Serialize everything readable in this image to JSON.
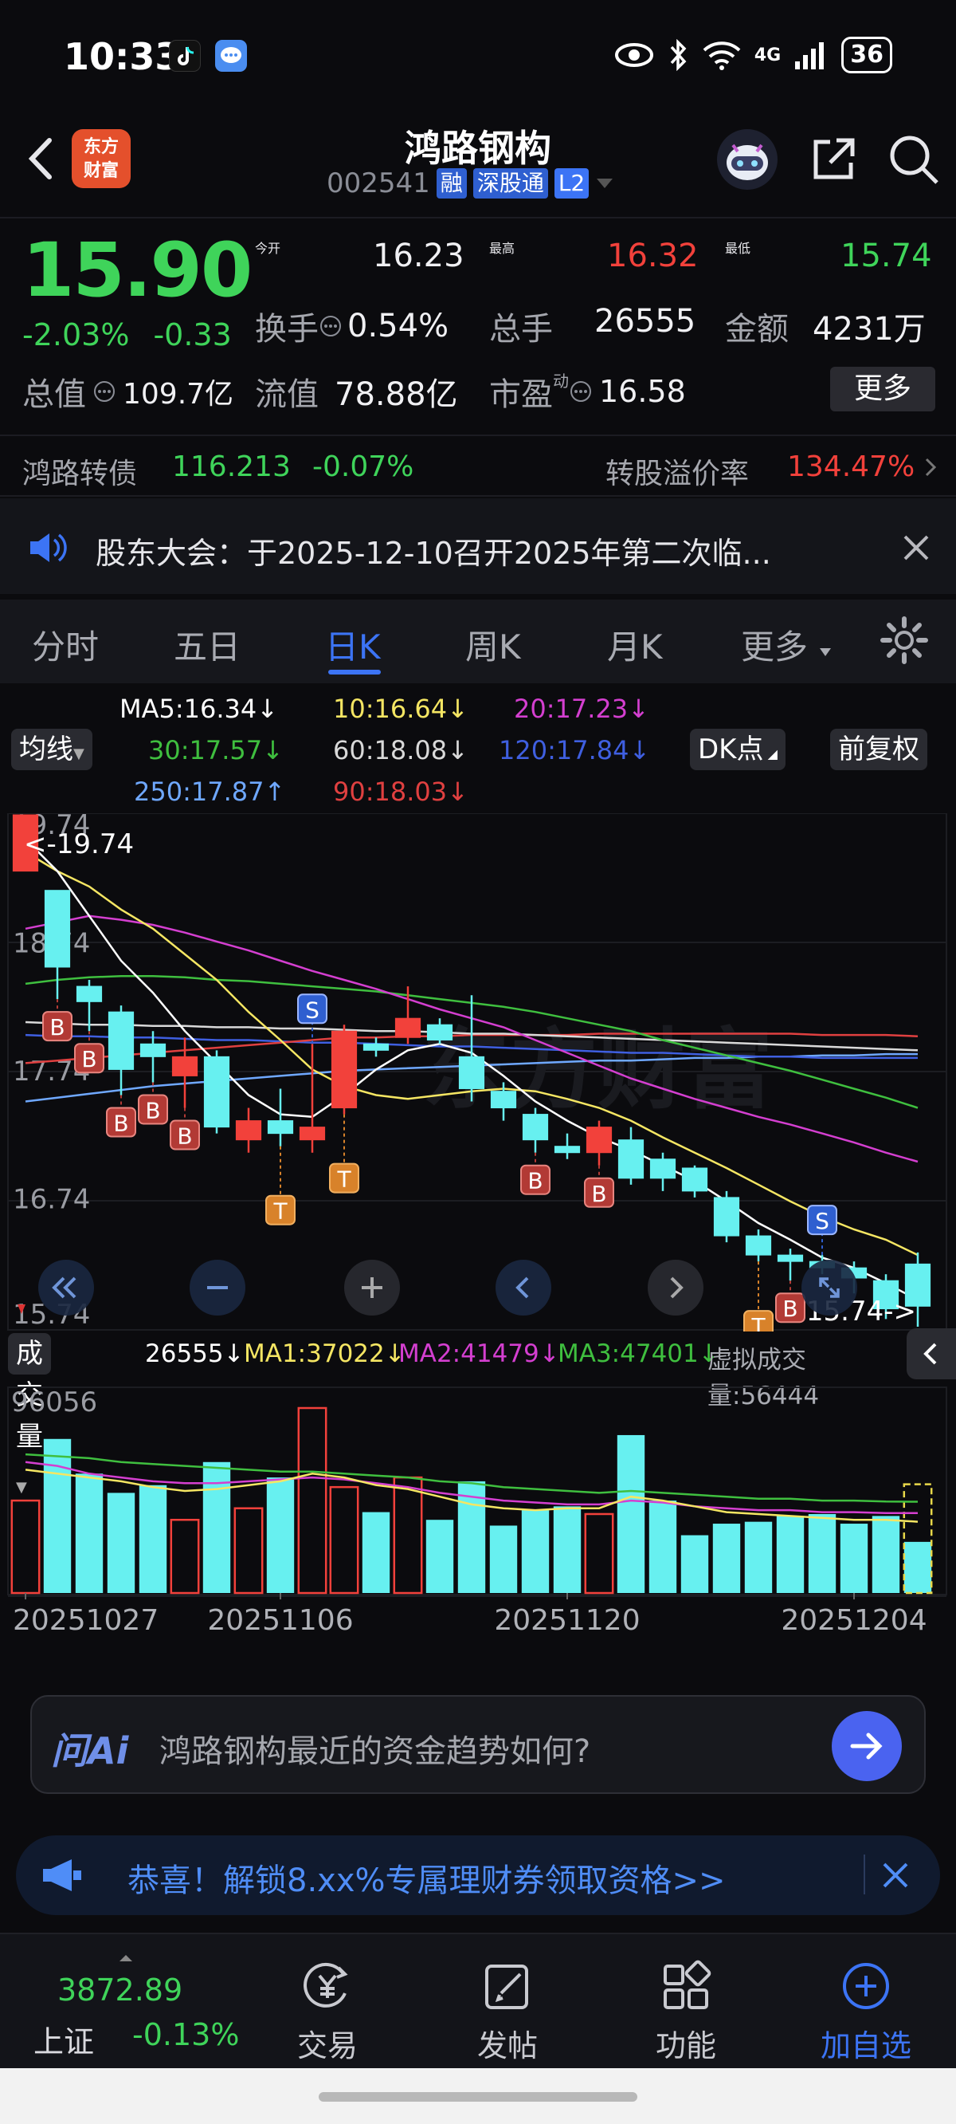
{
  "status_bar": {
    "time": "10:33",
    "network": "4G",
    "battery": "36"
  },
  "header": {
    "back_icon": "chevron-left-icon",
    "logo_text_1": "东方",
    "logo_text_2": "财富",
    "stock_name": "鸿路钢构",
    "stock_code": "002541",
    "tags": [
      "融",
      "深股通",
      "L2"
    ],
    "icons": [
      "robot-assistant-icon",
      "share-icon",
      "search-icon"
    ]
  },
  "quote": {
    "price": "15.90",
    "change_pct": "-2.03%",
    "change_amt": "-0.33",
    "open_label": "今开",
    "open": "16.23",
    "high_label": "最高",
    "high": "16.32",
    "low_label": "最低",
    "low": "15.74",
    "turnover_label": "换手",
    "turnover": "0.54%",
    "volume_label": "总手",
    "volume": "26555",
    "amount_label": "金额",
    "amount": "4231万",
    "mktcap_label": "总值",
    "mktcap": "109.7亿",
    "float_label": "流值",
    "float": "78.88亿",
    "pe_label": "市盈",
    "pe_sup": "动",
    "pe": "16.58",
    "more_label": "更多"
  },
  "convertible": {
    "name": "鸿路转债",
    "price": "116.213",
    "change": "-0.07%",
    "premium_label": "转股溢价率",
    "premium": "134.47%"
  },
  "notice": {
    "text": "股东大会：于2025-12-10召开2025年第二次临..."
  },
  "tabs": [
    {
      "label": "分时"
    },
    {
      "label": "五日"
    },
    {
      "label": "日K"
    },
    {
      "label": "周K"
    },
    {
      "label": "月K"
    },
    {
      "label": "更多"
    }
  ],
  "active_tab": "日K",
  "ma_legend": {
    "ma5": "MA5:16.34↓",
    "ma10": "10:16.64↓",
    "ma20": "20:17.23↓",
    "ma30": "30:17.57↓",
    "ma60": "60:18.08↓",
    "ma120": "120:17.84↓",
    "ma250": "250:17.87↑",
    "ma90": "90:18.03↓",
    "indicator_btn": "均线",
    "dk_btn": "DK点",
    "adjust_btn": "前复权"
  },
  "colors": {
    "up": "#f2413b",
    "down": "#67f0f0",
    "ma5": "#ffffff",
    "ma10": "#f5e663",
    "ma20": "#d43fd0",
    "ma30": "#3fbf3f",
    "ma60": "#d9d9d9",
    "ma120": "#3f5fe0",
    "ma250": "#6fa8ff",
    "ma90": "#e04040",
    "accent": "#3c74f5"
  },
  "chart_data": {
    "type": "candlestick",
    "price_axis": [
      "19.74",
      "18.74",
      "17.74",
      "16.74",
      "15.74"
    ],
    "ylim": [
      15.74,
      19.74
    ],
    "max_marker": "<-19.74",
    "min_marker": "15.74->",
    "date_labels": [
      "20251027",
      "20251106",
      "20251120",
      "20251204"
    ],
    "candles": [
      {
        "o": 19.3,
        "c": 19.74,
        "h": 19.74,
        "l": 19.3
      },
      {
        "o": 19.15,
        "c": 18.55,
        "h": 19.15,
        "l": 18.3
      },
      {
        "o": 18.4,
        "c": 18.28,
        "h": 18.45,
        "l": 18.05
      },
      {
        "o": 18.2,
        "c": 17.75,
        "h": 18.25,
        "l": 17.55
      },
      {
        "o": 17.95,
        "c": 17.85,
        "h": 18.05,
        "l": 17.65
      },
      {
        "o": 17.7,
        "c": 17.85,
        "h": 18.0,
        "l": 17.45
      },
      {
        "o": 17.85,
        "c": 17.3,
        "h": 17.9,
        "l": 17.25
      },
      {
        "o": 17.2,
        "c": 17.35,
        "h": 17.45,
        "l": 17.1
      },
      {
        "o": 17.35,
        "c": 17.25,
        "h": 17.6,
        "l": 17.15
      },
      {
        "o": 17.2,
        "c": 17.3,
        "h": 17.95,
        "l": 17.1
      },
      {
        "o": 17.45,
        "c": 18.05,
        "h": 18.1,
        "l": 17.4
      },
      {
        "o": 17.95,
        "c": 17.9,
        "h": 18.0,
        "l": 17.85
      },
      {
        "o": 18.0,
        "c": 18.15,
        "h": 18.4,
        "l": 17.95
      },
      {
        "o": 18.1,
        "c": 17.98,
        "h": 18.15,
        "l": 17.95
      },
      {
        "o": 17.85,
        "c": 17.6,
        "h": 18.33,
        "l": 17.5
      },
      {
        "o": 17.58,
        "c": 17.45,
        "h": 17.65,
        "l": 17.35
      },
      {
        "o": 17.4,
        "c": 17.2,
        "h": 17.45,
        "l": 17.1
      },
      {
        "o": 17.15,
        "c": 17.1,
        "h": 17.25,
        "l": 17.05
      },
      {
        "o": 17.1,
        "c": 17.3,
        "h": 17.35,
        "l": 17.0
      },
      {
        "o": 17.2,
        "c": 16.9,
        "h": 17.3,
        "l": 16.85
      },
      {
        "o": 17.05,
        "c": 16.9,
        "h": 17.1,
        "l": 16.8
      },
      {
        "o": 16.98,
        "c": 16.8,
        "h": 17.0,
        "l": 16.75
      },
      {
        "o": 16.75,
        "c": 16.45,
        "h": 16.8,
        "l": 16.4
      },
      {
        "o": 16.45,
        "c": 16.3,
        "h": 16.5,
        "l": 16.25
      },
      {
        "o": 16.3,
        "c": 16.25,
        "h": 16.35,
        "l": 16.1
      },
      {
        "o": 16.25,
        "c": 16.2,
        "h": 16.3,
        "l": 16.15
      },
      {
        "o": 16.2,
        "c": 16.12,
        "h": 16.25,
        "l": 16.0
      },
      {
        "o": 16.1,
        "c": 15.88,
        "h": 16.15,
        "l": 15.8
      },
      {
        "o": 16.23,
        "c": 15.9,
        "h": 16.32,
        "l": 15.74
      }
    ],
    "signals": [
      {
        "i": 1,
        "type": "B"
      },
      {
        "i": 2,
        "type": "B"
      },
      {
        "i": 3,
        "type": "B"
      },
      {
        "i": 4,
        "type": "B"
      },
      {
        "i": 5,
        "type": "B"
      },
      {
        "i": 8,
        "type": "T"
      },
      {
        "i": 9,
        "type": "S"
      },
      {
        "i": 10,
        "type": "T"
      },
      {
        "i": 16,
        "type": "B"
      },
      {
        "i": 18,
        "type": "B"
      },
      {
        "i": 23,
        "type": "T"
      },
      {
        "i": 24,
        "type": "B"
      },
      {
        "i": 25,
        "type": "S"
      }
    ],
    "ma_lines": {
      "ma5": [
        19.55,
        19.3,
        18.95,
        18.6,
        18.35,
        18.05,
        17.8,
        17.55,
        17.4,
        17.38,
        17.55,
        17.75,
        17.9,
        17.95,
        17.88,
        17.7,
        17.5,
        17.35,
        17.22,
        17.12,
        17.0,
        16.88,
        16.72,
        16.55,
        16.42,
        16.28,
        16.2,
        16.08,
        15.95
      ],
      "ma10": [
        19.45,
        19.3,
        19.18,
        19.0,
        18.85,
        18.65,
        18.45,
        18.2,
        17.98,
        17.75,
        17.62,
        17.55,
        17.52,
        17.55,
        17.58,
        17.6,
        17.58,
        17.52,
        17.45,
        17.35,
        17.22,
        17.1,
        16.98,
        16.85,
        16.72,
        16.6,
        16.5,
        16.42,
        16.3
      ],
      "ma20": [
        18.85,
        18.9,
        18.95,
        18.92,
        18.88,
        18.82,
        18.75,
        18.68,
        18.6,
        18.52,
        18.45,
        18.38,
        18.3,
        18.22,
        18.15,
        18.08,
        17.98,
        17.88,
        17.78,
        17.68,
        17.6,
        17.52,
        17.45,
        17.38,
        17.32,
        17.25,
        17.18,
        17.1,
        17.03
      ],
      "ma30": [
        18.42,
        18.45,
        18.47,
        18.48,
        18.48,
        18.47,
        18.45,
        18.44,
        18.42,
        18.4,
        18.38,
        18.36,
        18.33,
        18.3,
        18.27,
        18.24,
        18.2,
        18.15,
        18.1,
        18.05,
        17.98,
        17.92,
        17.86,
        17.8,
        17.74,
        17.67,
        17.6,
        17.53,
        17.45
      ],
      "ma60": [
        18.12,
        18.11,
        18.1,
        18.1,
        18.09,
        18.09,
        18.08,
        18.08,
        18.07,
        18.07,
        18.06,
        18.05,
        18.05,
        18.04,
        18.03,
        18.03,
        18.02,
        18.01,
        18.0,
        17.99,
        17.98,
        17.97,
        17.96,
        17.95,
        17.94,
        17.93,
        17.92,
        17.91,
        17.9
      ],
      "ma90": [
        17.8,
        17.82,
        17.84,
        17.86,
        17.88,
        17.9,
        17.92,
        17.94,
        17.96,
        17.98,
        18.0,
        18.0,
        18.01,
        18.01,
        18.02,
        18.02,
        18.02,
        18.02,
        18.03,
        18.03,
        18.03,
        18.03,
        18.03,
        18.03,
        18.03,
        18.02,
        18.02,
        18.02,
        18.01
      ],
      "ma120": [
        18.02,
        18.01,
        18.01,
        18.0,
        18.0,
        17.99,
        17.98,
        17.98,
        17.97,
        17.96,
        17.96,
        17.95,
        17.94,
        17.93,
        17.93,
        17.92,
        17.91,
        17.9,
        17.89,
        17.88,
        17.88,
        17.87,
        17.86,
        17.85,
        17.85,
        17.84,
        17.84,
        17.84,
        17.84
      ],
      "ma250": [
        17.5,
        17.53,
        17.56,
        17.59,
        17.62,
        17.64,
        17.66,
        17.68,
        17.7,
        17.72,
        17.74,
        17.75,
        17.76,
        17.77,
        17.78,
        17.79,
        17.8,
        17.81,
        17.82,
        17.82,
        17.83,
        17.84,
        17.84,
        17.85,
        17.85,
        17.86,
        17.86,
        17.87,
        17.87
      ]
    },
    "volume": {
      "label": "成交量",
      "current": "26555↓",
      "ma1": "MA1:37022↓",
      "ma2": "MA2:41479↓",
      "ma3": "MA3:47401↓",
      "virtual": "虚拟成交量:56444",
      "max_label": "96056",
      "ylim": [
        0,
        96056
      ],
      "values": [
        48000,
        80000,
        62000,
        52000,
        56000,
        38000,
        68000,
        44000,
        60000,
        96056,
        55000,
        42000,
        60000,
        38000,
        58000,
        35000,
        43000,
        45000,
        41000,
        82000,
        48000,
        30000,
        36000,
        37000,
        40000,
        41000,
        36000,
        40000,
        26555
      ],
      "virtual_value": 56444,
      "ma1_line": [
        64000,
        62000,
        60000,
        58000,
        55000,
        53000,
        54000,
        56000,
        58000,
        62000,
        60000,
        56000,
        54000,
        50000,
        46000,
        44000,
        43000,
        44000,
        44000,
        50000,
        48000,
        45000,
        42000,
        41000,
        40000,
        39000,
        38000,
        38000,
        37022
      ],
      "ma2_line": [
        68000,
        66000,
        62000,
        60000,
        58000,
        57000,
        57000,
        58000,
        59000,
        60000,
        59000,
        57000,
        55000,
        52000,
        50000,
        48000,
        47000,
        46000,
        46000,
        48000,
        47000,
        45000,
        44000,
        43000,
        43000,
        42000,
        42000,
        41500,
        41479
      ],
      "ma3_line": [
        72000,
        71000,
        70000,
        68000,
        67000,
        66000,
        65000,
        64000,
        63000,
        63000,
        62000,
        61000,
        60000,
        58000,
        57000,
        55000,
        54000,
        53000,
        52000,
        53000,
        52000,
        51000,
        50000,
        49000,
        49000,
        48000,
        48000,
        47500,
        47401
      ]
    }
  },
  "chart_controls": [
    "double-left-arrow-icon",
    "zoom-out-icon",
    "zoom-in-icon",
    "left-arrow-icon",
    "right-arrow-icon",
    "fullscreen-icon"
  ],
  "ai": {
    "logo": "问Ai",
    "prompt": "鸿路钢构最近的资金趋势如何?"
  },
  "promo": {
    "text": "恭喜！解锁8.xx%专属理财券领取资格>>"
  },
  "bottom_nav": {
    "index_value": "3872.89",
    "index_name": "上证",
    "index_change": "-0.13%",
    "items": [
      {
        "label": "交易",
        "icon": "yen-exchange-icon"
      },
      {
        "label": "发帖",
        "icon": "edit-post-icon"
      },
      {
        "label": "功能",
        "icon": "grid-apps-icon"
      },
      {
        "label": "加自选",
        "icon": "add-circle-icon"
      }
    ]
  }
}
